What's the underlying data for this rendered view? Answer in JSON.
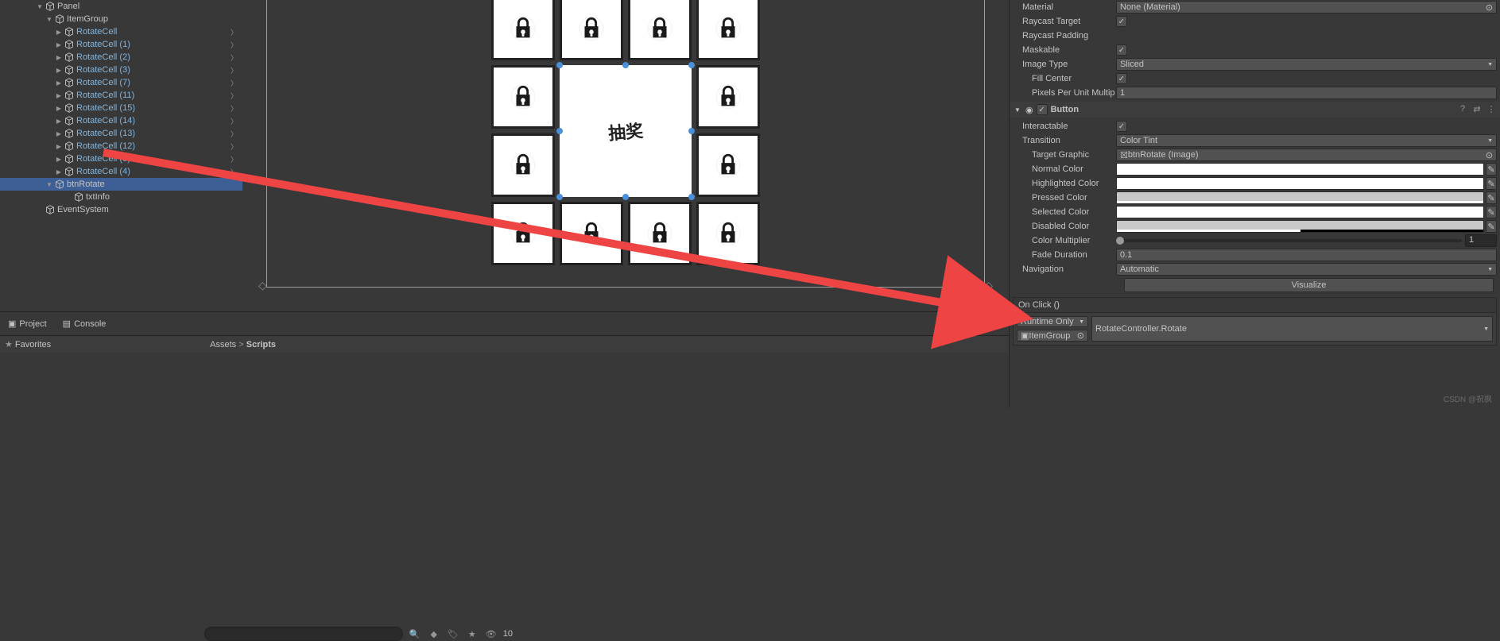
{
  "hierarchy": {
    "items": [
      {
        "indent": 40,
        "arrow": "open",
        "label": "Panel",
        "prefab": false,
        "chev": false,
        "sel": false
      },
      {
        "indent": 52,
        "arrow": "open",
        "label": "ItemGroup",
        "prefab": false,
        "chev": false,
        "sel": false
      },
      {
        "indent": 64,
        "arrow": "closed",
        "label": "RotateCell",
        "prefab": true,
        "chev": true,
        "sel": false
      },
      {
        "indent": 64,
        "arrow": "closed",
        "label": "RotateCell (1)",
        "prefab": true,
        "chev": true,
        "sel": false
      },
      {
        "indent": 64,
        "arrow": "closed",
        "label": "RotateCell (2)",
        "prefab": true,
        "chev": true,
        "sel": false
      },
      {
        "indent": 64,
        "arrow": "closed",
        "label": "RotateCell (3)",
        "prefab": true,
        "chev": true,
        "sel": false
      },
      {
        "indent": 64,
        "arrow": "closed",
        "label": "RotateCell (7)",
        "prefab": true,
        "chev": true,
        "sel": false
      },
      {
        "indent": 64,
        "arrow": "closed",
        "label": "RotateCell (11)",
        "prefab": true,
        "chev": true,
        "sel": false
      },
      {
        "indent": 64,
        "arrow": "closed",
        "label": "RotateCell (15)",
        "prefab": true,
        "chev": true,
        "sel": false
      },
      {
        "indent": 64,
        "arrow": "closed",
        "label": "RotateCell (14)",
        "prefab": true,
        "chev": true,
        "sel": false
      },
      {
        "indent": 64,
        "arrow": "closed",
        "label": "RotateCell (13)",
        "prefab": true,
        "chev": true,
        "sel": false
      },
      {
        "indent": 64,
        "arrow": "closed",
        "label": "RotateCell (12)",
        "prefab": true,
        "chev": true,
        "sel": false
      },
      {
        "indent": 64,
        "arrow": "closed",
        "label": "RotateCell (8)",
        "prefab": true,
        "chev": true,
        "sel": false
      },
      {
        "indent": 64,
        "arrow": "closed",
        "label": "RotateCell (4)",
        "prefab": true,
        "chev": true,
        "sel": false
      },
      {
        "indent": 52,
        "arrow": "open",
        "label": "btnRotate",
        "prefab": false,
        "chev": false,
        "sel": true
      },
      {
        "indent": 76,
        "arrow": "",
        "label": "txtInfo",
        "prefab": false,
        "chev": false,
        "sel": false
      },
      {
        "indent": 40,
        "arrow": "",
        "label": "EventSystem",
        "prefab": false,
        "chev": false,
        "sel": false
      }
    ]
  },
  "scene": {
    "center_label": "抽奖"
  },
  "tabs": {
    "project": "Project",
    "console": "Console",
    "favorites": "Favorites",
    "breadcrumb_assets": "Assets",
    "breadcrumb_scripts": "Scripts",
    "hidden_count": "10"
  },
  "inspector": {
    "material_lbl": "Material",
    "material_val": "None (Material)",
    "raycast_target": "Raycast Target",
    "raycast_padding": "Raycast Padding",
    "maskable": "Maskable",
    "image_type": "Image Type",
    "image_type_val": "Sliced",
    "fill_center": "Fill Center",
    "ppu": "Pixels Per Unit Multip",
    "ppu_val": "1",
    "button_comp": "Button",
    "interactable": "Interactable",
    "transition": "Transition",
    "transition_val": "Color Tint",
    "target_graphic": "Target Graphic",
    "target_graphic_val": "btnRotate (Image)",
    "normal_color": "Normal Color",
    "highlighted_color": "Highlighted Color",
    "pressed_color": "Pressed Color",
    "selected_color": "Selected Color",
    "disabled_color": "Disabled Color",
    "color_multiplier": "Color Multiplier",
    "color_multiplier_val": "1",
    "fade_duration": "Fade Duration",
    "fade_duration_val": "0.1",
    "navigation": "Navigation",
    "navigation_val": "Automatic",
    "visualize": "Visualize",
    "onclick_header": "On Click ()",
    "runtime": "Runtime Only",
    "method": "RotateController.Rotate",
    "target_obj": "ItemGroup"
  },
  "watermark": "CSDN @祝枫"
}
